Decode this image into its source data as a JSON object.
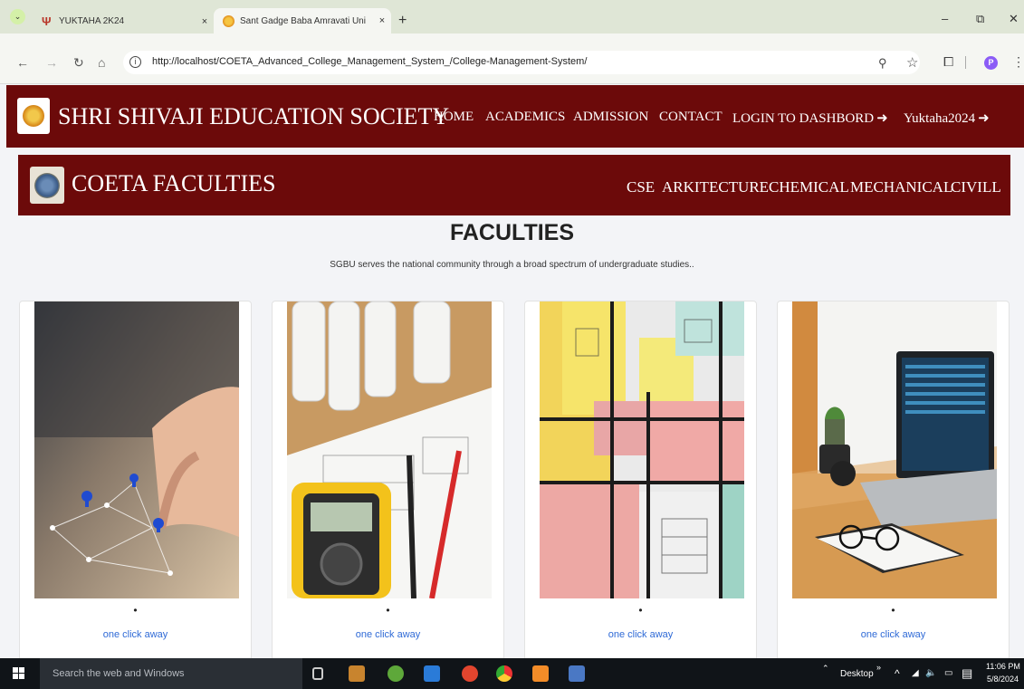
{
  "browser": {
    "tabs": [
      {
        "title": "YUKTAHA 2K24",
        "close": "×"
      },
      {
        "title": "Sant Gadge Baba Amravati Uni",
        "close": "×"
      }
    ],
    "newtab": "+",
    "url": "http://localhost/COETA_Advanced_College_Management_System_/College-Management-System/"
  },
  "header": {
    "brand": "SHRI SHIVAJI EDUCATION SOCIETY",
    "nav": [
      "HOME",
      "ACADEMICS",
      "ADMISSION",
      "CONTACT",
      "LOGIN TO DASHBORD",
      "Yuktaha2024"
    ]
  },
  "subheader": {
    "brand": "COETA FACULTIES",
    "nav": [
      "CSE",
      "ARKITECTURE",
      "CHEMICAL",
      "MECHANICAL",
      "CIVILL"
    ]
  },
  "section": {
    "title": "FACULTIES",
    "subtitle": "SGBU serves the national community through a broad spectrum of undergraduate studies.."
  },
  "cards": [
    {
      "dot": "•",
      "link": "one click away",
      "image": "network-pins-image"
    },
    {
      "dot": "•",
      "link": "one click away",
      "image": "multimeter-blueprints-image"
    },
    {
      "dot": "•",
      "link": "one click away",
      "image": "floor-plan-image"
    },
    {
      "dot": "•",
      "link": "one click away",
      "image": "laptop-desk-image"
    }
  ],
  "taskbar": {
    "search_placeholder": "Search the web and Windows",
    "desktop": "Desktop",
    "time": "11:06 PM",
    "date": "5/8/2024"
  },
  "colors": {
    "header_bg": "#6c0a0a",
    "link": "#2f6ad6"
  }
}
